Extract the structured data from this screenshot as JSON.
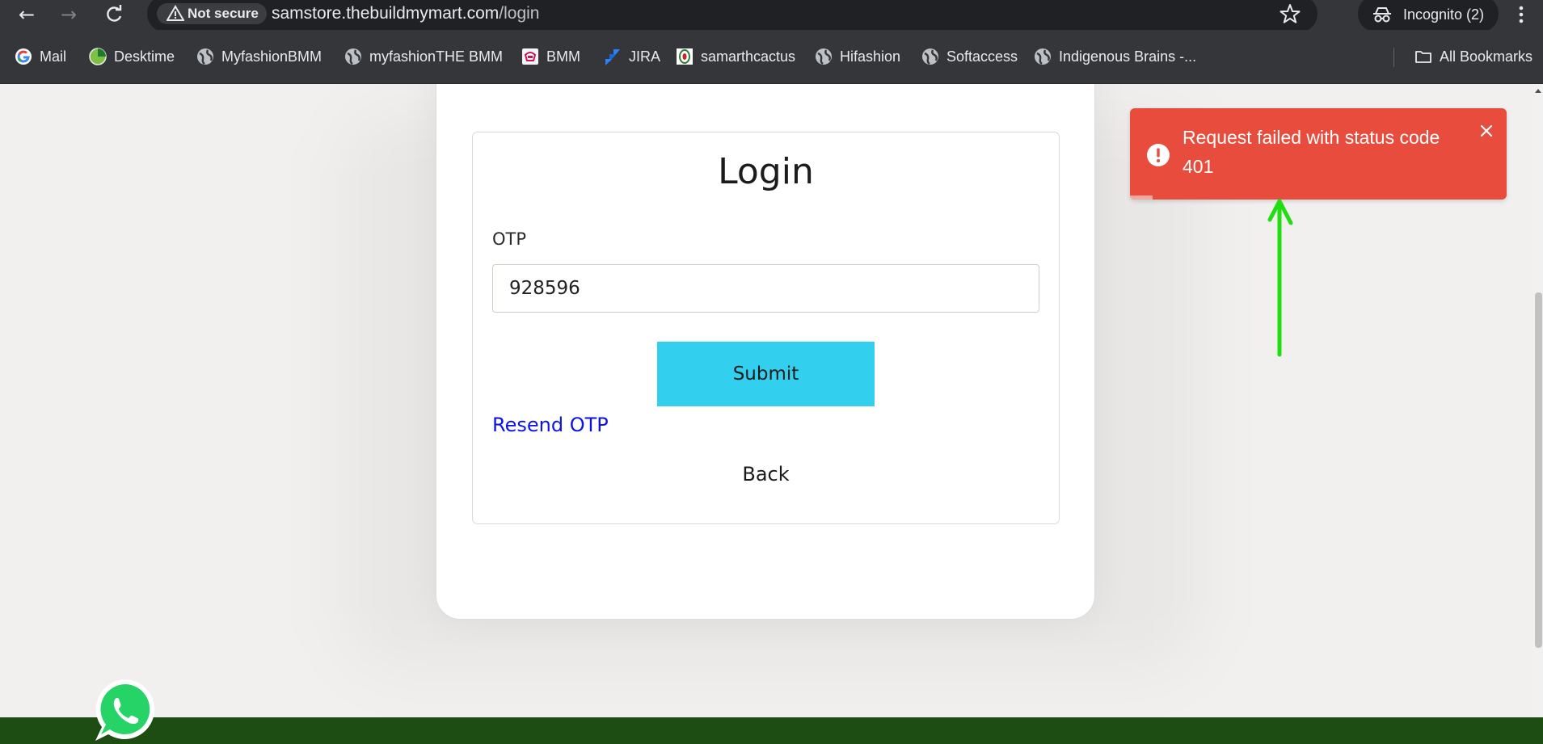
{
  "browser": {
    "security_label": "Not secure",
    "url_host": "samstore.thebuildmymart.com",
    "url_path": "/login",
    "incognito_label": "Incognito (2)"
  },
  "bookmarks": [
    {
      "label": "Mail",
      "icon": "google-icon"
    },
    {
      "label": "Desktime",
      "icon": "desktime-icon"
    },
    {
      "label": "MyfashionBMM",
      "icon": "globe-icon"
    },
    {
      "label": "myfashionTHE BMM",
      "icon": "globe-icon"
    },
    {
      "label": "BMM",
      "icon": "bmm-icon"
    },
    {
      "label": "JIRA",
      "icon": "jira-icon"
    },
    {
      "label": "samarthcactus",
      "icon": "samarth-icon"
    },
    {
      "label": "Hifashion",
      "icon": "globe-icon"
    },
    {
      "label": "Softaccess",
      "icon": "globe-icon"
    },
    {
      "label": "Indigenous Brains -...",
      "icon": "globe-icon"
    }
  ],
  "all_bookmarks_label": "All Bookmarks",
  "login": {
    "title": "Login",
    "otp_label": "OTP",
    "otp_value": "928596",
    "submit_label": "Submit",
    "resend_label": "Resend OTP",
    "back_label": "Back"
  },
  "toast": {
    "message": "Request failed with status code 401"
  },
  "colors": {
    "toast_bg": "#e74c3c",
    "submit_bg": "#32cfef",
    "resend_link": "#0d12e6",
    "footer_band": "#1d4d12",
    "annotation_arrow": "#22dd11"
  }
}
